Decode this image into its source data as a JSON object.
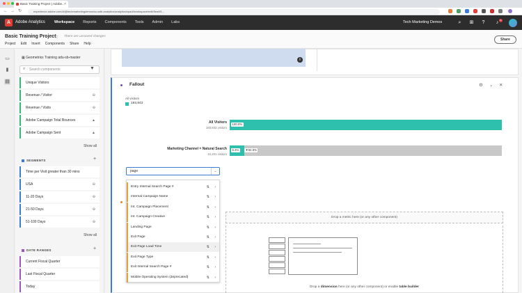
{
  "browser": {
    "tab_title": "Basic Training Project | Adobe...",
    "url": "experience.adobe.com/#/@techmarketingdemos/so:adb-analytics/analytics/spa/#/workspace/edit/5ea4f1..."
  },
  "appbar": {
    "app_name": "Adobe Analytics",
    "nav": [
      "Workspace",
      "Reports",
      "Components",
      "Tools",
      "Admin",
      "Labs"
    ],
    "active_nav": "Workspace",
    "company": "Tech Marketing Demos",
    "notification_count": "9+"
  },
  "project": {
    "title": "Basic Training Project",
    "status": "There are unsaved changes",
    "menu": [
      "Project",
      "Edit",
      "Insert",
      "Components",
      "Share",
      "Help"
    ],
    "share_label": "Share"
  },
  "panel": {
    "report_suite": "Geometrixx Training adu-sb-master",
    "search_placeholder": "Search components",
    "metrics": [
      {
        "label": "Unique Visitors",
        "icon": ""
      },
      {
        "label": "Revenue / Visitor",
        "icon": "⊖"
      },
      {
        "label": "Revenue / Visits",
        "icon": "⊖"
      },
      {
        "label": "Adobe Campaign Total Bounces",
        "icon": "▲"
      },
      {
        "label": "Adobe Campaign Sent",
        "icon": "▲"
      }
    ],
    "show_all_1": "Show all",
    "segments_header": "SEGMENTS",
    "segments": [
      {
        "label": "Time per Visit greater than 30 mins",
        "icon": ""
      },
      {
        "label": "USA",
        "icon": "⊖"
      },
      {
        "label": "11-20 Days",
        "icon": "⊖"
      },
      {
        "label": "21-50 Days",
        "icon": "⊖"
      },
      {
        "label": "51-100 Days",
        "icon": "⊖"
      }
    ],
    "show_all_2": "Show all",
    "dateranges_header": "DATE RANGES",
    "dateranges": [
      {
        "label": "Current Fiscal Quarter"
      },
      {
        "label": "Last Fiscal Quarter"
      },
      {
        "label": "Today"
      }
    ],
    "colors": {
      "metric": "#2fbf71",
      "segment": "#3a7bd5",
      "daterange": "#9b59b6"
    }
  },
  "fallout": {
    "title": "Fallout",
    "legend_label": "All visitors",
    "legend_value": "193,843",
    "steps": [
      {
        "title": "All Visitors",
        "sub": "193,843 visitors",
        "fill_pct": 100,
        "label": "100.0%"
      },
      {
        "title": "Marketing Channel = Natural Search",
        "sub": "10,201 visitors",
        "fill_pct": 5.4,
        "label": "5.4%",
        "fallout_label": "▼94.6%"
      }
    ]
  },
  "dropdown": {
    "value": "page",
    "options": [
      {
        "label": "Entry Internal Search Page #",
        "hover": false
      },
      {
        "label": "Internal Campaign Name",
        "hover": false
      },
      {
        "label": "Int. Campaign Placement",
        "hover": false
      },
      {
        "label": "Int. Campaign Creative",
        "hover": false
      },
      {
        "label": "Landing Page",
        "hover": false
      },
      {
        "label": "Exit Page",
        "hover": false
      },
      {
        "label": "Exit Page Load Time",
        "hover": true
      },
      {
        "label": "Exit Page Type",
        "hover": false
      },
      {
        "label": "Exit Internal Search Page #",
        "hover": false
      },
      {
        "label": "Mobile Operating System (deprecated)",
        "hover": false
      }
    ]
  },
  "freeform": {
    "drop_metric": "Drop a metric here (or any other component)",
    "drop_dimension_pre": "Drop a",
    "drop_dimension_word": "dimension",
    "drop_dimension_mid": "here (or any other component) or enable",
    "drop_dimension_link": "table builder"
  }
}
